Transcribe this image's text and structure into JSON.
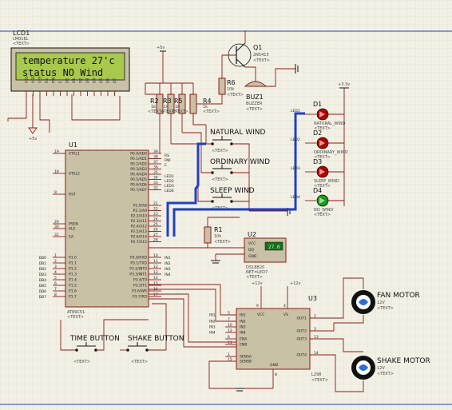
{
  "lcd": {
    "ref": "LCD1",
    "part": "LM016L",
    "text_tag": "<TEXT>",
    "line1": "temperature 27'c",
    "line2": "status   NO Wind",
    "pins": [
      "VSS",
      "VDD",
      "VEE",
      "RS",
      "RW",
      "E",
      "D0",
      "D1",
      "D2",
      "D3",
      "D4",
      "D5",
      "D6",
      "D7"
    ]
  },
  "power_labels": {
    "plus5v_a": "+5v",
    "plus5v_b": "+5v",
    "plus33v": "+3.3v",
    "plus12v_a": "+12v",
    "plus12v_b": "+12v"
  },
  "transistor": {
    "ref": "Q1",
    "part": "2N5415",
    "text_tag": "<TEXT>"
  },
  "buzzer": {
    "ref": "BUZ1",
    "part": "BUZZER",
    "text_tag": "<TEXT>"
  },
  "resistors": [
    {
      "ref": "R6",
      "value": "10k",
      "text_tag": "<TEXT>"
    },
    {
      "ref": "R2",
      "value": "1k",
      "text_tag": "<TEXT>"
    },
    {
      "ref": "R3",
      "value": "1k",
      "text_tag": "<TEXT>"
    },
    {
      "ref": "R5",
      "value": "1k",
      "text_tag": "<TEXT>"
    },
    {
      "ref": "R4",
      "value": "1k",
      "text_tag": "<TEXT>"
    },
    {
      "ref": "R1",
      "value": "10k",
      "text_tag": "<TEXT>"
    }
  ],
  "mcu": {
    "ref": "U1",
    "part": "AT89C51",
    "text_tag": "<TEXT>",
    "left_pins": [
      {
        "num": "19",
        "name": "XTAL1"
      },
      {
        "num": "18",
        "name": "XTAL2"
      },
      {
        "num": "9",
        "name": "RST"
      },
      {
        "num": "29",
        "name": "PSEN"
      },
      {
        "num": "30",
        "name": "ALE"
      },
      {
        "num": "31",
        "name": "EA"
      },
      {
        "num": "1",
        "name": "P1.0"
      },
      {
        "num": "2",
        "name": "P1.1"
      },
      {
        "num": "3",
        "name": "P1.2"
      },
      {
        "num": "4",
        "name": "P1.3"
      },
      {
        "num": "5",
        "name": "P1.4"
      },
      {
        "num": "6",
        "name": "P1.5"
      },
      {
        "num": "7",
        "name": "P1.6"
      },
      {
        "num": "8",
        "name": "P1.7"
      }
    ],
    "left_nets": [
      "DB0",
      "DB1",
      "DB2",
      "DB3",
      "DB4",
      "DB5",
      "DB6",
      "DB7"
    ],
    "right_pins": [
      {
        "num": "39",
        "name": "P0.0/AD0"
      },
      {
        "num": "38",
        "name": "P0.1/AD1"
      },
      {
        "num": "37",
        "name": "P0.2/AD2"
      },
      {
        "num": "36",
        "name": "P0.3/AD3"
      },
      {
        "num": "35",
        "name": "P0.4/AD4"
      },
      {
        "num": "34",
        "name": "P0.5/AD5"
      },
      {
        "num": "33",
        "name": "P0.6/AD6"
      },
      {
        "num": "32",
        "name": "P0.7/AD7"
      },
      {
        "num": "21",
        "name": "P2.0/A8"
      },
      {
        "num": "22",
        "name": "P2.1/A9"
      },
      {
        "num": "23",
        "name": "P2.2/A10"
      },
      {
        "num": "24",
        "name": "P2.3/A11"
      },
      {
        "num": "25",
        "name": "P2.4/A12"
      },
      {
        "num": "26",
        "name": "P2.5/A13"
      },
      {
        "num": "27",
        "name": "P2.6/A14"
      },
      {
        "num": "28",
        "name": "P2.7/A15"
      },
      {
        "num": "10",
        "name": "P3.0/RXD"
      },
      {
        "num": "11",
        "name": "P3.1/TXD"
      },
      {
        "num": "12",
        "name": "P3.2/INT0"
      },
      {
        "num": "13",
        "name": "P3.3/INT1"
      },
      {
        "num": "14",
        "name": "P3.4/T0"
      },
      {
        "num": "15",
        "name": "P3.5/T1"
      },
      {
        "num": "16",
        "name": "P3.6/WR"
      },
      {
        "num": "17",
        "name": "P3.7/RD"
      }
    ],
    "right_nets": [
      "RS",
      "RW",
      "E",
      "LED1",
      "LED2",
      "LED3",
      "LED4",
      "IN1",
      "IN2",
      "IN3",
      "IN4"
    ]
  },
  "switches": [
    {
      "label": "NATURAL WIND",
      "text_tag": "<TEXT>"
    },
    {
      "label": "ORDINARY WIND",
      "text_tag": "<TEXT>"
    },
    {
      "label": "SLEEP WIND",
      "text_tag": "<TEXT>"
    },
    {
      "label": "TIME BUTTON",
      "text_tag": "<TEXT>"
    },
    {
      "label": "SHAKE BUTTON",
      "text_tag": "<TEXT>"
    }
  ],
  "leds": [
    {
      "ref": "D1",
      "part": "NATURAL_WIND",
      "net": "LED1",
      "text_tag": "<TEXT>",
      "color": "#b30000"
    },
    {
      "ref": "D2",
      "part": "ORDINARY_WIND",
      "net": "LED2",
      "text_tag": "<TEXT>",
      "color": "#b30000"
    },
    {
      "ref": "D3",
      "part": "SLEEP_WIND",
      "net": "LED3",
      "text_tag": "<TEXT>",
      "color": "#b30000"
    },
    {
      "ref": "D4",
      "part": "NO_WIND",
      "net": "LED4",
      "text_tag": "<TEXT>",
      "color": "#1a9a1a"
    }
  ],
  "sensor": {
    "ref": "U2",
    "part": "DS18B20",
    "net": "NET=LED7",
    "text_tag": "<TEXT>",
    "pins": [
      "VCC",
      "DQ",
      "GND"
    ],
    "display": "27.0"
  },
  "driver": {
    "ref": "U3",
    "part": "L298",
    "text_tag": "<TEXT>",
    "left_pins": [
      {
        "num": "5",
        "name": "IN1"
      },
      {
        "num": "7",
        "name": "IN2"
      },
      {
        "num": "10",
        "name": "IN3"
      },
      {
        "num": "12",
        "name": "IN4"
      },
      {
        "num": "6",
        "name": "ENA"
      },
      {
        "num": "11",
        "name": "ENB"
      },
      {
        "num": "1",
        "name": "SENSA"
      },
      {
        "num": "15",
        "name": "SENSB"
      }
    ],
    "top_pins": [
      "VCC",
      "VS"
    ],
    "right_pins": [
      {
        "num": "2",
        "name": "OUT1"
      },
      {
        "num": "3",
        "name": "OUT2"
      },
      {
        "num": "13",
        "name": "OUT3"
      },
      {
        "num": "14",
        "name": "OUT4"
      }
    ],
    "bottom_pin": "GND",
    "top_nums": [
      "9",
      "4"
    ],
    "bottom_nums": [
      "8"
    ],
    "nets": [
      "IN1",
      "IN2",
      "IN3",
      "IN4"
    ]
  },
  "motors": [
    {
      "label": "FAN MOTOR",
      "voltage": "12V",
      "text_tag": "<TEXT>"
    },
    {
      "label": "SHAKE MOTOR",
      "voltage": "12V",
      "text_tag": "<TEXT>"
    }
  ],
  "colors": {
    "wire": "#8b1a1a",
    "bus": "#1f3fc4",
    "lcd_bg": "#a9c94e",
    "led_red": "#b30000",
    "led_green": "#1a9a1a",
    "sheet": "#f2f0e4",
    "grid": "#d9d6c6"
  }
}
